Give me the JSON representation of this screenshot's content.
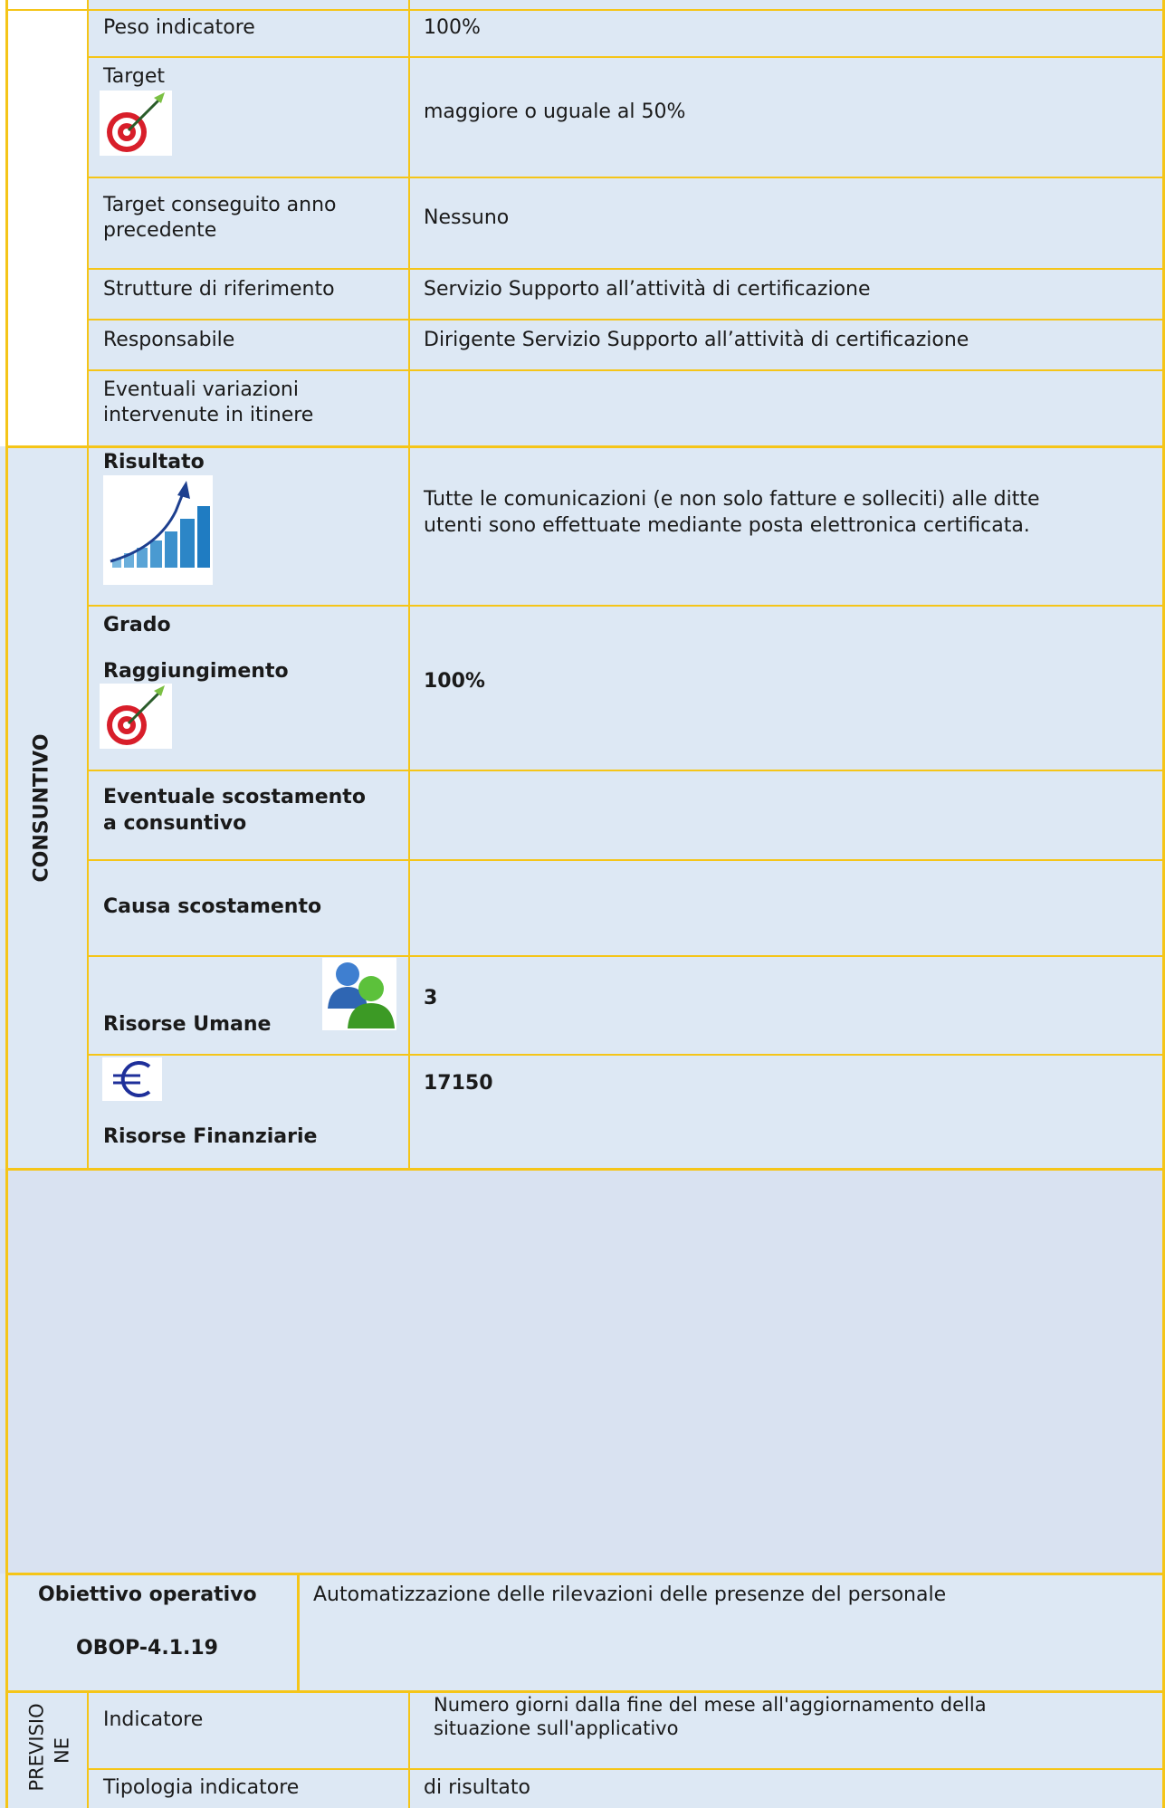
{
  "top_section": {
    "rows": [
      {
        "label": "Peso indicatore",
        "value": "100%"
      },
      {
        "label": "Target",
        "value": "maggiore o uguale al 50%",
        "icon": "target-dart-icon"
      },
      {
        "label_lines": [
          "Target conseguito anno",
          "precedente"
        ],
        "value": "Nessuno"
      },
      {
        "label": "Strutture di riferimento",
        "value": "Servizio Supporto all’attività di certificazione"
      },
      {
        "label": "Responsabile",
        "value": "Dirigente Servizio Supporto all’attività di certificazione"
      },
      {
        "label_lines": [
          "Eventuali variazioni",
          "intervenute in itinere"
        ],
        "value": ""
      }
    ]
  },
  "consuntivo": {
    "section_label": "CONSUNTIVO",
    "rows": [
      {
        "label": "Risultato",
        "icon": "growth-chart-icon",
        "value_lines": [
          "Tutte le comunicazioni (e non solo fatture e solleciti) alle ditte",
          "utenti sono effettuate mediante posta elettronica certificata."
        ]
      },
      {
        "label_lines": [
          "Grado",
          "Raggiungimento"
        ],
        "icon": "target-dart-icon",
        "value": "100%"
      },
      {
        "label_lines": [
          "Eventuale scostamento",
          "a consuntivo"
        ],
        "value": ""
      },
      {
        "label": "Causa scostamento",
        "value": ""
      },
      {
        "label": "Risorse Umane",
        "icon": "users-icon",
        "value": "3"
      },
      {
        "label": "Risorse Finanziarie",
        "icon": "euro-icon",
        "value": "17150"
      }
    ]
  },
  "objective": {
    "label": "Obiettivo operativo",
    "code": "OBOP-4.1.19",
    "description": "Automatizzazione delle rilevazioni delle presenze del personale"
  },
  "previsione": {
    "section_label_lines": [
      "PREVISIO",
      "NE"
    ],
    "rows": [
      {
        "label": "Indicatore",
        "value_lines": [
          "Numero giorni dalla fine del mese all'aggiornamento della",
          "situazione sull'applicativo"
        ]
      },
      {
        "label": "Tipologia indicatore",
        "value": "di risultato"
      }
    ]
  },
  "colors": {
    "border": "#f5c518",
    "cell": "#dde8f4",
    "band": "#d9e2f1"
  }
}
